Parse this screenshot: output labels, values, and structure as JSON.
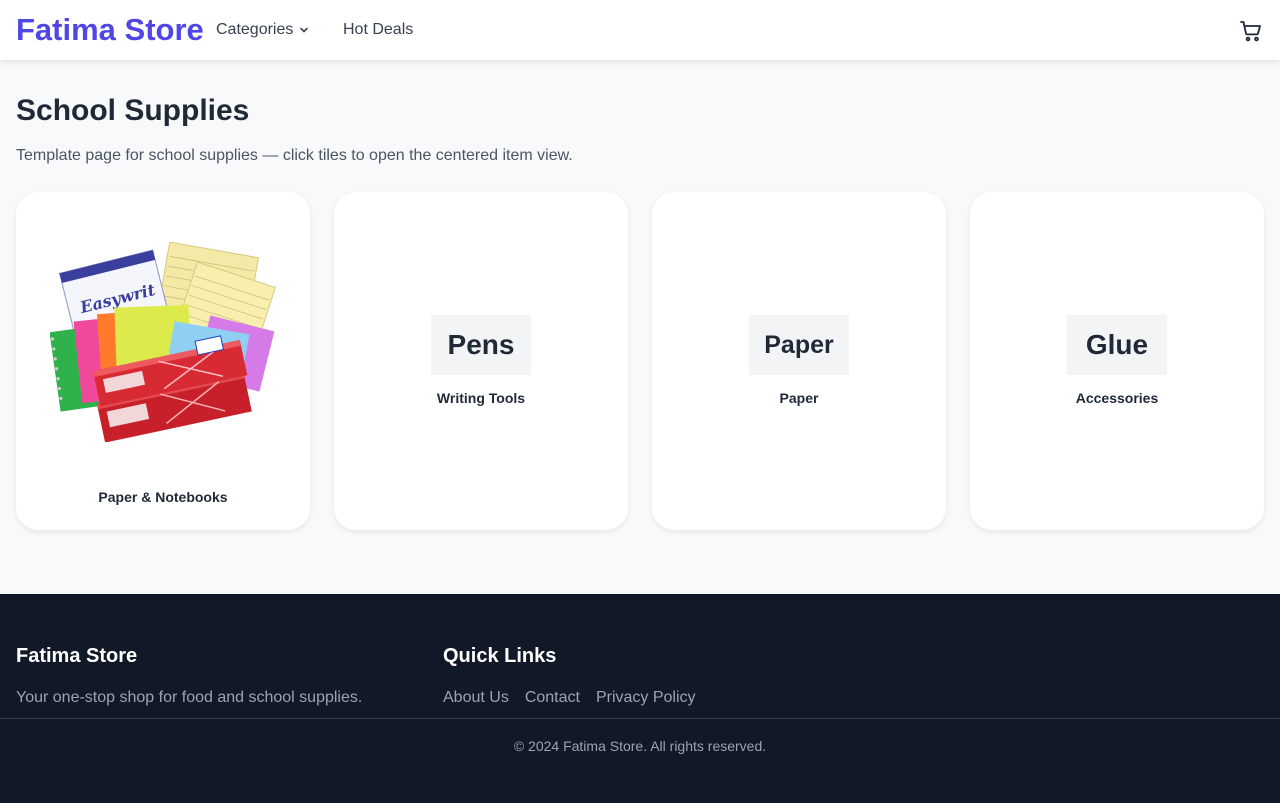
{
  "header": {
    "brand": "Fatima Store",
    "nav": {
      "categories": "Categories",
      "hot_deals": "Hot Deals"
    },
    "cart_icon": "cart-icon"
  },
  "main": {
    "title": "School Supplies",
    "subtitle": "Template page for school supplies — click tiles to open the centered item view.",
    "tiles": [
      {
        "caption": "Paper & Notebooks",
        "image": "paper-notebooks-photo"
      },
      {
        "thumb": "Pens",
        "caption": "Writing Tools"
      },
      {
        "thumb": "Paper",
        "caption": "Paper"
      },
      {
        "thumb": "Glue",
        "caption": "Accessories"
      }
    ]
  },
  "footer": {
    "brand": "Fatima Store",
    "tagline": "Your one-stop shop for food and school supplies.",
    "quick_links_title": "Quick Links",
    "links": [
      "About Us",
      "Contact",
      "Privacy Policy"
    ],
    "copyright": "© 2024 Fatima Store. All rights reserved."
  },
  "colors": {
    "brand": "#4f46e5",
    "footer_bg": "#111827",
    "page_bg": "#f8f9fb"
  }
}
